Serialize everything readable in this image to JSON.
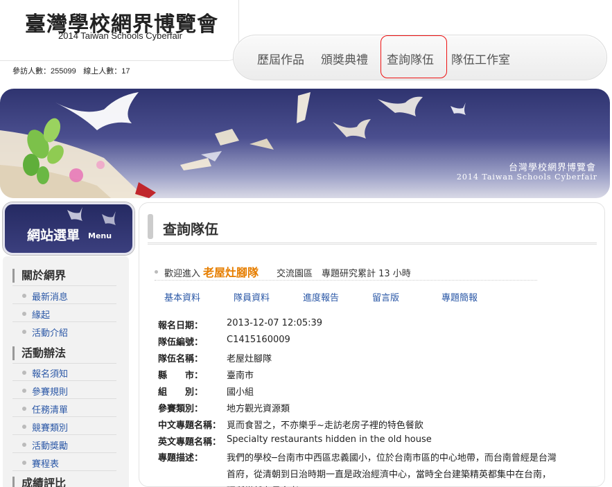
{
  "header": {
    "title": "臺灣學校網界博覽會",
    "subtitle": "2014 Taiwan Schools Cyberfair",
    "visitors_label": "參訪人數：",
    "visitors_count": "255099",
    "online_label": "線上人數：",
    "online_count": "17"
  },
  "nav": {
    "items": [
      "歷屆作品",
      "頒獎典禮",
      "查詢隊伍",
      "隊伍工作室"
    ],
    "active": "查詢隊伍"
  },
  "banner": {
    "title": "台灣學校網界博覽會",
    "subtitle": "2014 Taiwan Schools Cyberfair"
  },
  "sidebar": {
    "badge_cn": "網站選單",
    "badge_en": "Menu",
    "sections": [
      {
        "title": "關於網界",
        "items": [
          "最新消息",
          "緣起",
          "活動介紹"
        ]
      },
      {
        "title": "活動辦法",
        "items": [
          "報名須知",
          "參賽規則",
          "任務清單",
          "競賽類別",
          "活動獎勵",
          "賽程表"
        ]
      },
      {
        "title": "成績評比",
        "items": []
      }
    ]
  },
  "main": {
    "page_title": "查詢隊伍",
    "welcome_pre": "歡迎進入",
    "team_name": "老屋灶腳隊",
    "welcome_post": "交流園區　專題研究累計 13 小時",
    "tabs": [
      "基本資料",
      "隊員資料",
      "進度報告",
      "留言版",
      "專題簡報"
    ],
    "info": [
      {
        "label": "報名日期：",
        "value": "2013-12-07 12:05:39"
      },
      {
        "label": "隊伍編號：",
        "value": "C1415160009"
      },
      {
        "label": "隊伍名稱：",
        "value": "老屋灶腳隊"
      },
      {
        "label": "縣　　市：",
        "value": "臺南市"
      },
      {
        "label": "組　　別：",
        "value": "國小組"
      },
      {
        "label": "參賽類別：",
        "value": "地方觀光資源類"
      },
      {
        "label": "中文專題名稱：",
        "value": "覓而食習之，不亦樂乎~走訪老房子裡的特色餐飲"
      },
      {
        "label": "英文專題名稱：",
        "value": "Specialty restaurants hidden in the old house"
      }
    ],
    "desc_label": "專題描述：",
    "desc_text": "我們的學校─台南市中西區忠義國小，位於台南市區的中心地帶，而台南曾經是台灣首府，從清朝到日治時期一直是政治經濟中心，當時全台建築精英都集中在台南，理所當然有最多老"
  },
  "colors": {
    "accent_orange": "#e67e00",
    "link_blue": "#2a57a6",
    "banner_navy": "#2f3470",
    "active_outline": "#e11111"
  }
}
